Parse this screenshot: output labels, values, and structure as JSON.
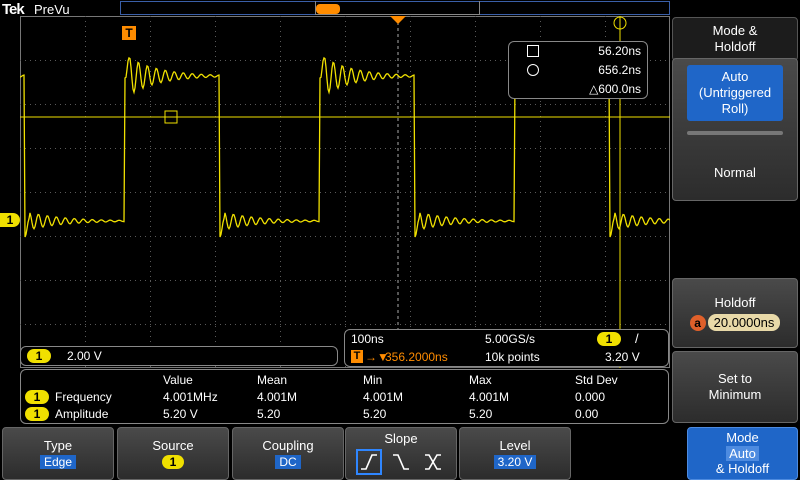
{
  "header": {
    "logo": "Tek",
    "status": "PreVu"
  },
  "side_menu": {
    "title": "Mode & Holdoff",
    "auto_label": "Auto (Untriggered Roll)",
    "normal_label": "Normal",
    "holdoff_label": "Holdoff",
    "holdoff_badge": "a",
    "holdoff_value": "20.0000ns",
    "set_min_label": "Set to Minimum"
  },
  "cursor_readout": {
    "a_value": "56.20ns",
    "b_value": "656.2ns",
    "delta_value": "△600.0ns"
  },
  "channel_readout": {
    "channel": "1",
    "scale": "2.00 V"
  },
  "timebase_readout": {
    "horizontal_scale": "100ns",
    "sample_rate": "5.00GS/s",
    "trigger_channel": "1",
    "trigger_slope_symbol": "/",
    "position": "356.2000ns",
    "record_length": "10k points",
    "trigger_level": "3.20 V"
  },
  "measurements": {
    "headers": [
      "Value",
      "Mean",
      "Min",
      "Max",
      "Std Dev"
    ],
    "rows": [
      {
        "channel": "1",
        "name": "Frequency",
        "values": [
          "4.001MHz",
          "4.001M",
          "4.001M",
          "4.001M",
          "0.000"
        ]
      },
      {
        "channel": "1",
        "name": "Amplitude",
        "values": [
          "5.20 V",
          "5.20",
          "5.20",
          "5.20",
          "0.00"
        ]
      }
    ]
  },
  "markers": {
    "channel_ground": "1",
    "trigger_marker": "T"
  },
  "bottom_menu": {
    "type_label": "Type",
    "type_value": "Edge",
    "source_label": "Source",
    "source_value": "1",
    "coupling_label": "Coupling",
    "coupling_value": "DC",
    "slope_label": "Slope",
    "level_label": "Level",
    "level_value": "3.20 V",
    "mode_line1": "Mode",
    "mode_line2": "Auto",
    "mode_line3": "& Holdoff"
  },
  "colors": {
    "trace": "#f0e000",
    "accent": "#1f66c8",
    "trigger": "#ff8c00",
    "grid": "#707070"
  }
}
